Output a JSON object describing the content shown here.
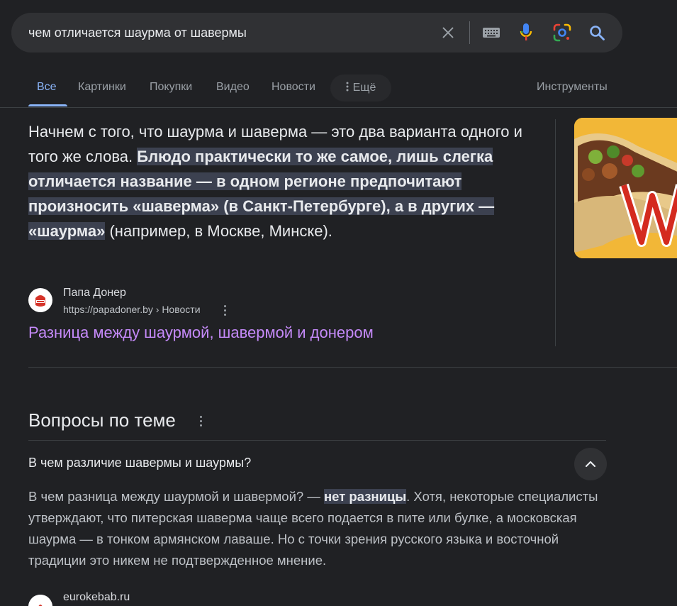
{
  "search": {
    "query": "чем отличается шаурма от шавермы"
  },
  "tabs": [
    {
      "label": "Все",
      "active": true
    },
    {
      "label": "Картинки"
    },
    {
      "label": "Покупки"
    },
    {
      "label": "Видео"
    },
    {
      "label": "Новости"
    }
  ],
  "more_tab": {
    "label": "Ещё"
  },
  "tools_label": "Инструменты",
  "snippet": {
    "part1": "Начнем с того, что шаурма и шаверма — это два варианта одного и того же слова. ",
    "highlight": "Блюдо практически то же самое, лишь слегка отличается название — в одном регионе предпочитают произносить «шаверма» (в Санкт-Петербурге), а в других — «шаурма»",
    "part2": " (например, в Москве, Минске)."
  },
  "source": {
    "name": "Папа Донер",
    "url": "https://papadoner.by › Новости",
    "favicon": "papadoner-logo"
  },
  "result_link": "Разница между шаурмой, шавермой и донером",
  "paa": {
    "title": "Вопросы по теме",
    "question": "В чем различие шавермы и шаурмы?",
    "answer_part1": "В чем разница между шаурмой и шавермой? — ",
    "answer_highlight": "нет разницы",
    "answer_part2": ". Хотя, некоторые специалисты утверждают, что питерская шаверма чаще всего подается в пите или булке, а московская шаурма — в тонком армянском лаваше. Но с точки зрения русского языка и восточной традиции это никем не подтвержденное мнение.",
    "source_name": "eurokebab.ru"
  },
  "colors": {
    "background": "#202124",
    "accent": "#8ab4f8",
    "visited_link": "#c58af9",
    "highlight": "#3c4150"
  }
}
